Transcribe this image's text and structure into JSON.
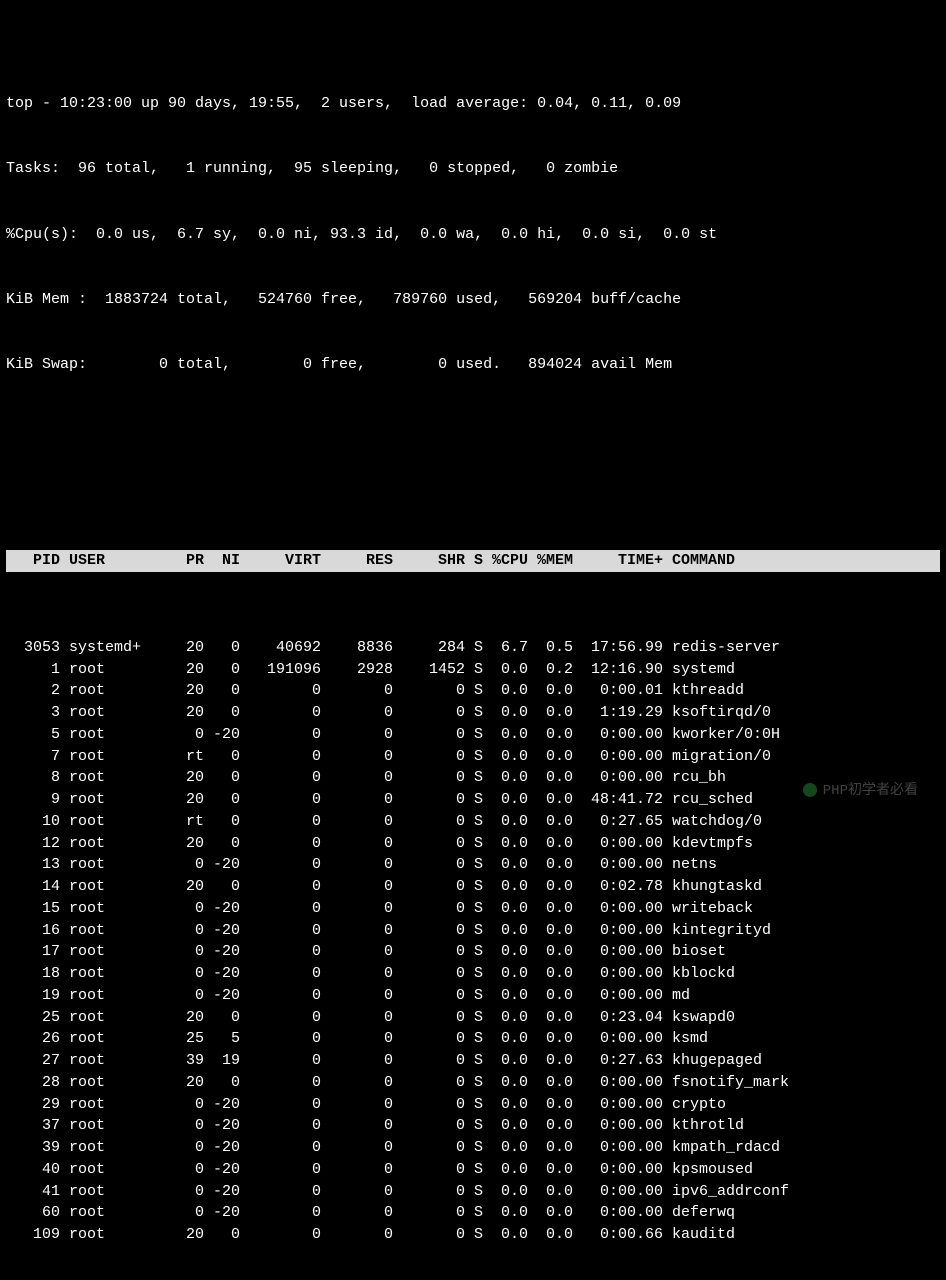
{
  "summary_lines": [
    "top - 10:23:00 up 90 days, 19:55,  2 users,  load average: 0.04, 0.11, 0.09",
    "Tasks:  96 total,   1 running,  95 sleeping,   0 stopped,   0 zombie",
    "%Cpu(s):  0.0 us,  6.7 sy,  0.0 ni, 93.3 id,  0.0 wa,  0.0 hi,  0.0 si,  0.0 st",
    "KiB Mem :  1883724 total,   524760 free,   789760 used,   569204 buff/cache",
    "KiB Swap:        0 total,        0 free,        0 used.   894024 avail Mem"
  ],
  "columns": [
    "PID",
    "USER",
    "PR",
    "NI",
    "VIRT",
    "RES",
    "SHR",
    "S",
    "%CPU",
    "%MEM",
    "TIME+",
    "COMMAND"
  ],
  "processes": [
    {
      "pid": "3053",
      "user": "systemd+",
      "pr": "20",
      "ni": "0",
      "virt": "40692",
      "res": "8836",
      "shr": "284",
      "s": "S",
      "cpu": "6.7",
      "mem": "0.5",
      "time": "17:56.99",
      "cmd": "redis-server"
    },
    {
      "pid": "1",
      "user": "root",
      "pr": "20",
      "ni": "0",
      "virt": "191096",
      "res": "2928",
      "shr": "1452",
      "s": "S",
      "cpu": "0.0",
      "mem": "0.2",
      "time": "12:16.90",
      "cmd": "systemd"
    },
    {
      "pid": "2",
      "user": "root",
      "pr": "20",
      "ni": "0",
      "virt": "0",
      "res": "0",
      "shr": "0",
      "s": "S",
      "cpu": "0.0",
      "mem": "0.0",
      "time": "0:00.01",
      "cmd": "kthreadd"
    },
    {
      "pid": "3",
      "user": "root",
      "pr": "20",
      "ni": "0",
      "virt": "0",
      "res": "0",
      "shr": "0",
      "s": "S",
      "cpu": "0.0",
      "mem": "0.0",
      "time": "1:19.29",
      "cmd": "ksoftirqd/0"
    },
    {
      "pid": "5",
      "user": "root",
      "pr": "0",
      "ni": "-20",
      "virt": "0",
      "res": "0",
      "shr": "0",
      "s": "S",
      "cpu": "0.0",
      "mem": "0.0",
      "time": "0:00.00",
      "cmd": "kworker/0:0H"
    },
    {
      "pid": "7",
      "user": "root",
      "pr": "rt",
      "ni": "0",
      "virt": "0",
      "res": "0",
      "shr": "0",
      "s": "S",
      "cpu": "0.0",
      "mem": "0.0",
      "time": "0:00.00",
      "cmd": "migration/0"
    },
    {
      "pid": "8",
      "user": "root",
      "pr": "20",
      "ni": "0",
      "virt": "0",
      "res": "0",
      "shr": "0",
      "s": "S",
      "cpu": "0.0",
      "mem": "0.0",
      "time": "0:00.00",
      "cmd": "rcu_bh"
    },
    {
      "pid": "9",
      "user": "root",
      "pr": "20",
      "ni": "0",
      "virt": "0",
      "res": "0",
      "shr": "0",
      "s": "S",
      "cpu": "0.0",
      "mem": "0.0",
      "time": "48:41.72",
      "cmd": "rcu_sched"
    },
    {
      "pid": "10",
      "user": "root",
      "pr": "rt",
      "ni": "0",
      "virt": "0",
      "res": "0",
      "shr": "0",
      "s": "S",
      "cpu": "0.0",
      "mem": "0.0",
      "time": "0:27.65",
      "cmd": "watchdog/0"
    },
    {
      "pid": "12",
      "user": "root",
      "pr": "20",
      "ni": "0",
      "virt": "0",
      "res": "0",
      "shr": "0",
      "s": "S",
      "cpu": "0.0",
      "mem": "0.0",
      "time": "0:00.00",
      "cmd": "kdevtmpfs"
    },
    {
      "pid": "13",
      "user": "root",
      "pr": "0",
      "ni": "-20",
      "virt": "0",
      "res": "0",
      "shr": "0",
      "s": "S",
      "cpu": "0.0",
      "mem": "0.0",
      "time": "0:00.00",
      "cmd": "netns"
    },
    {
      "pid": "14",
      "user": "root",
      "pr": "20",
      "ni": "0",
      "virt": "0",
      "res": "0",
      "shr": "0",
      "s": "S",
      "cpu": "0.0",
      "mem": "0.0",
      "time": "0:02.78",
      "cmd": "khungtaskd"
    },
    {
      "pid": "15",
      "user": "root",
      "pr": "0",
      "ni": "-20",
      "virt": "0",
      "res": "0",
      "shr": "0",
      "s": "S",
      "cpu": "0.0",
      "mem": "0.0",
      "time": "0:00.00",
      "cmd": "writeback"
    },
    {
      "pid": "16",
      "user": "root",
      "pr": "0",
      "ni": "-20",
      "virt": "0",
      "res": "0",
      "shr": "0",
      "s": "S",
      "cpu": "0.0",
      "mem": "0.0",
      "time": "0:00.00",
      "cmd": "kintegrityd"
    },
    {
      "pid": "17",
      "user": "root",
      "pr": "0",
      "ni": "-20",
      "virt": "0",
      "res": "0",
      "shr": "0",
      "s": "S",
      "cpu": "0.0",
      "mem": "0.0",
      "time": "0:00.00",
      "cmd": "bioset"
    },
    {
      "pid": "18",
      "user": "root",
      "pr": "0",
      "ni": "-20",
      "virt": "0",
      "res": "0",
      "shr": "0",
      "s": "S",
      "cpu": "0.0",
      "mem": "0.0",
      "time": "0:00.00",
      "cmd": "kblockd"
    },
    {
      "pid": "19",
      "user": "root",
      "pr": "0",
      "ni": "-20",
      "virt": "0",
      "res": "0",
      "shr": "0",
      "s": "S",
      "cpu": "0.0",
      "mem": "0.0",
      "time": "0:00.00",
      "cmd": "md"
    },
    {
      "pid": "25",
      "user": "root",
      "pr": "20",
      "ni": "0",
      "virt": "0",
      "res": "0",
      "shr": "0",
      "s": "S",
      "cpu": "0.0",
      "mem": "0.0",
      "time": "0:23.04",
      "cmd": "kswapd0"
    },
    {
      "pid": "26",
      "user": "root",
      "pr": "25",
      "ni": "5",
      "virt": "0",
      "res": "0",
      "shr": "0",
      "s": "S",
      "cpu": "0.0",
      "mem": "0.0",
      "time": "0:00.00",
      "cmd": "ksmd"
    },
    {
      "pid": "27",
      "user": "root",
      "pr": "39",
      "ni": "19",
      "virt": "0",
      "res": "0",
      "shr": "0",
      "s": "S",
      "cpu": "0.0",
      "mem": "0.0",
      "time": "0:27.63",
      "cmd": "khugepaged"
    },
    {
      "pid": "28",
      "user": "root",
      "pr": "20",
      "ni": "0",
      "virt": "0",
      "res": "0",
      "shr": "0",
      "s": "S",
      "cpu": "0.0",
      "mem": "0.0",
      "time": "0:00.00",
      "cmd": "fsnotify_mark"
    },
    {
      "pid": "29",
      "user": "root",
      "pr": "0",
      "ni": "-20",
      "virt": "0",
      "res": "0",
      "shr": "0",
      "s": "S",
      "cpu": "0.0",
      "mem": "0.0",
      "time": "0:00.00",
      "cmd": "crypto"
    },
    {
      "pid": "37",
      "user": "root",
      "pr": "0",
      "ni": "-20",
      "virt": "0",
      "res": "0",
      "shr": "0",
      "s": "S",
      "cpu": "0.0",
      "mem": "0.0",
      "time": "0:00.00",
      "cmd": "kthrotld"
    },
    {
      "pid": "39",
      "user": "root",
      "pr": "0",
      "ni": "-20",
      "virt": "0",
      "res": "0",
      "shr": "0",
      "s": "S",
      "cpu": "0.0",
      "mem": "0.0",
      "time": "0:00.00",
      "cmd": "kmpath_rdacd"
    },
    {
      "pid": "40",
      "user": "root",
      "pr": "0",
      "ni": "-20",
      "virt": "0",
      "res": "0",
      "shr": "0",
      "s": "S",
      "cpu": "0.0",
      "mem": "0.0",
      "time": "0:00.00",
      "cmd": "kpsmoused"
    },
    {
      "pid": "41",
      "user": "root",
      "pr": "0",
      "ni": "-20",
      "virt": "0",
      "res": "0",
      "shr": "0",
      "s": "S",
      "cpu": "0.0",
      "mem": "0.0",
      "time": "0:00.00",
      "cmd": "ipv6_addrconf"
    },
    {
      "pid": "60",
      "user": "root",
      "pr": "0",
      "ni": "-20",
      "virt": "0",
      "res": "0",
      "shr": "0",
      "s": "S",
      "cpu": "0.0",
      "mem": "0.0",
      "time": "0:00.00",
      "cmd": "deferwq"
    },
    {
      "pid": "109",
      "user": "root",
      "pr": "20",
      "ni": "0",
      "virt": "0",
      "res": "0",
      "shr": "0",
      "s": "S",
      "cpu": "0.0",
      "mem": "0.0",
      "time": "0:00.66",
      "cmd": "kauditd"
    }
  ],
  "watermark": "PHP初学者必看"
}
